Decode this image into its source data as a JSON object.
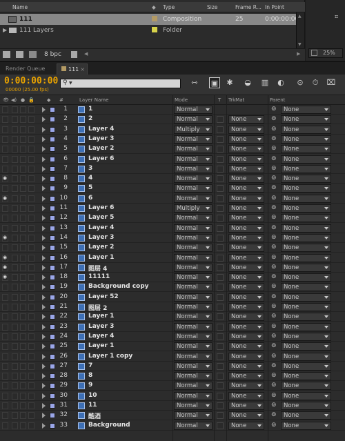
{
  "project_panel": {
    "headers": {
      "name": "Name",
      "type": "Type",
      "size": "Size",
      "frame_rate": "Frame R...",
      "in_point": "In Point"
    },
    "items": [
      {
        "name": "111",
        "type": "Composition",
        "size": "",
        "frame_rate": "25",
        "in_point": "0:00:00:00",
        "selected": true,
        "icon": "composition-icon",
        "swatch": "#b39a64"
      },
      {
        "name": "111 Layers",
        "type": "Folder",
        "size": "",
        "frame_rate": "",
        "in_point": "",
        "selected": false,
        "icon": "folder-icon",
        "swatch": "#d7d24a"
      }
    ],
    "bpc": "8 bpc",
    "zoom": "25%"
  },
  "tabs": [
    {
      "label": "Render Queue",
      "active": false
    },
    {
      "label": "111",
      "active": true
    }
  ],
  "timeline": {
    "timecode": "0:00:00:00",
    "fps": "00000 (25.00 fps)",
    "search_placeholder": "",
    "columns": {
      "layer_name": "Layer Name",
      "mode": "Mode",
      "t": "T",
      "trkmat": "TrkMat",
      "parent": "Parent",
      "hash": "#"
    },
    "layers": [
      {
        "num": "1",
        "name": "1",
        "mode": "Normal",
        "trkmat": "",
        "parent": "None",
        "eye": false
      },
      {
        "num": "2",
        "name": "2",
        "mode": "Normal",
        "trkmat": "None",
        "parent": "None",
        "eye": false
      },
      {
        "num": "3",
        "name": "Layer 4",
        "mode": "Multiply",
        "trkmat": "None",
        "parent": "None",
        "eye": false
      },
      {
        "num": "4",
        "name": "Layer 3",
        "mode": "Normal",
        "trkmat": "None",
        "parent": "None",
        "eye": false
      },
      {
        "num": "5",
        "name": "Layer 2",
        "mode": "Normal",
        "trkmat": "None",
        "parent": "None",
        "eye": false
      },
      {
        "num": "6",
        "name": "Layer 6",
        "mode": "Normal",
        "trkmat": "None",
        "parent": "None",
        "eye": false
      },
      {
        "num": "7",
        "name": "3",
        "mode": "Normal",
        "trkmat": "None",
        "parent": "None",
        "eye": false
      },
      {
        "num": "8",
        "name": "4",
        "mode": "Normal",
        "trkmat": "None",
        "parent": "None",
        "eye": true
      },
      {
        "num": "9",
        "name": "5",
        "mode": "Normal",
        "trkmat": "None",
        "parent": "None",
        "eye": false
      },
      {
        "num": "10",
        "name": "6",
        "mode": "Normal",
        "trkmat": "None",
        "parent": "None",
        "eye": true
      },
      {
        "num": "11",
        "name": "Layer 6",
        "mode": "Multiply",
        "trkmat": "None",
        "parent": "None",
        "eye": false
      },
      {
        "num": "12",
        "name": "Layer 5",
        "mode": "Normal",
        "trkmat": "None",
        "parent": "None",
        "eye": false
      },
      {
        "num": "13",
        "name": "Layer 4",
        "mode": "Normal",
        "trkmat": "None",
        "parent": "None",
        "eye": false
      },
      {
        "num": "14",
        "name": "Layer 3",
        "mode": "Normal",
        "trkmat": "None",
        "parent": "None",
        "eye": true
      },
      {
        "num": "15",
        "name": "Layer 2",
        "mode": "Normal",
        "trkmat": "None",
        "parent": "None",
        "eye": false
      },
      {
        "num": "16",
        "name": "Layer 1",
        "mode": "Normal",
        "trkmat": "None",
        "parent": "None",
        "eye": true
      },
      {
        "num": "17",
        "name": "图层 4",
        "mode": "Normal",
        "trkmat": "None",
        "parent": "None",
        "eye": true
      },
      {
        "num": "18",
        "name": "11111",
        "mode": "Normal",
        "trkmat": "None",
        "parent": "None",
        "eye": true
      },
      {
        "num": "19",
        "name": "Background copy",
        "mode": "Normal",
        "trkmat": "None",
        "parent": "None",
        "eye": false
      },
      {
        "num": "20",
        "name": "Layer 52",
        "mode": "Normal",
        "trkmat": "None",
        "parent": "None",
        "eye": false
      },
      {
        "num": "21",
        "name": "图层 2",
        "mode": "Normal",
        "trkmat": "None",
        "parent": "None",
        "eye": false
      },
      {
        "num": "22",
        "name": "Layer 1",
        "mode": "Normal",
        "trkmat": "None",
        "parent": "None",
        "eye": false
      },
      {
        "num": "23",
        "name": "Layer 3",
        "mode": "Normal",
        "trkmat": "None",
        "parent": "None",
        "eye": false
      },
      {
        "num": "24",
        "name": "Layer 4",
        "mode": "Normal",
        "trkmat": "None",
        "parent": "None",
        "eye": false
      },
      {
        "num": "25",
        "name": "Layer 1",
        "mode": "Normal",
        "trkmat": "None",
        "parent": "None",
        "eye": false
      },
      {
        "num": "26",
        "name": "Layer 1 copy",
        "mode": "Normal",
        "trkmat": "None",
        "parent": "None",
        "eye": false
      },
      {
        "num": "27",
        "name": "7",
        "mode": "Normal",
        "trkmat": "None",
        "parent": "None",
        "eye": false
      },
      {
        "num": "28",
        "name": "8",
        "mode": "Normal",
        "trkmat": "None",
        "parent": "None",
        "eye": false
      },
      {
        "num": "29",
        "name": "9",
        "mode": "Normal",
        "trkmat": "None",
        "parent": "None",
        "eye": false
      },
      {
        "num": "30",
        "name": "10",
        "mode": "Normal",
        "trkmat": "None",
        "parent": "None",
        "eye": false
      },
      {
        "num": "31",
        "name": "11",
        "mode": "Normal",
        "trkmat": "None",
        "parent": "None",
        "eye": false
      },
      {
        "num": "32",
        "name": "酷酒",
        "mode": "Normal",
        "trkmat": "None",
        "parent": "None",
        "eye": false
      },
      {
        "num": "33",
        "name": "Background",
        "mode": "Normal",
        "trkmat": "None",
        "parent": "None",
        "eye": false
      }
    ]
  },
  "colors": {
    "timecode": "#e8a200",
    "label": "#9aa6e8",
    "selected_row": "#888888"
  }
}
